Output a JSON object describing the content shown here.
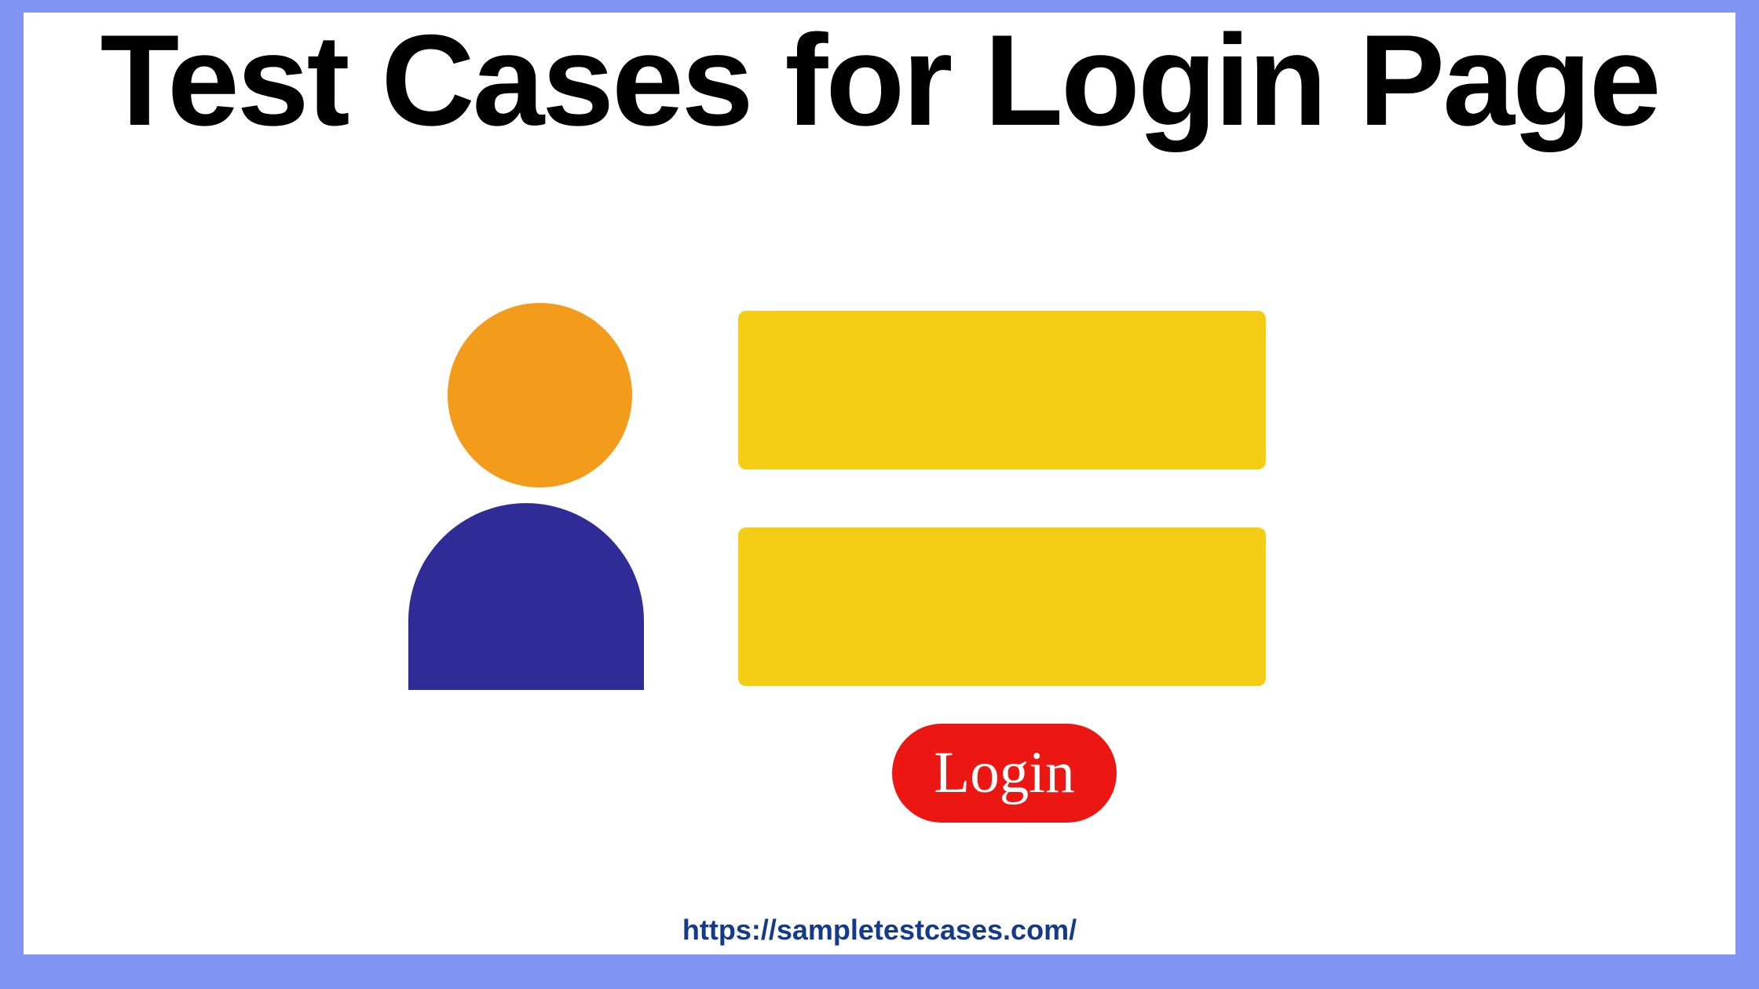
{
  "header": {
    "title": "Test Cases for Login Page"
  },
  "form": {
    "login_button_label": "Login"
  },
  "footer": {
    "url_text": "https://sampletestcases.com/"
  }
}
